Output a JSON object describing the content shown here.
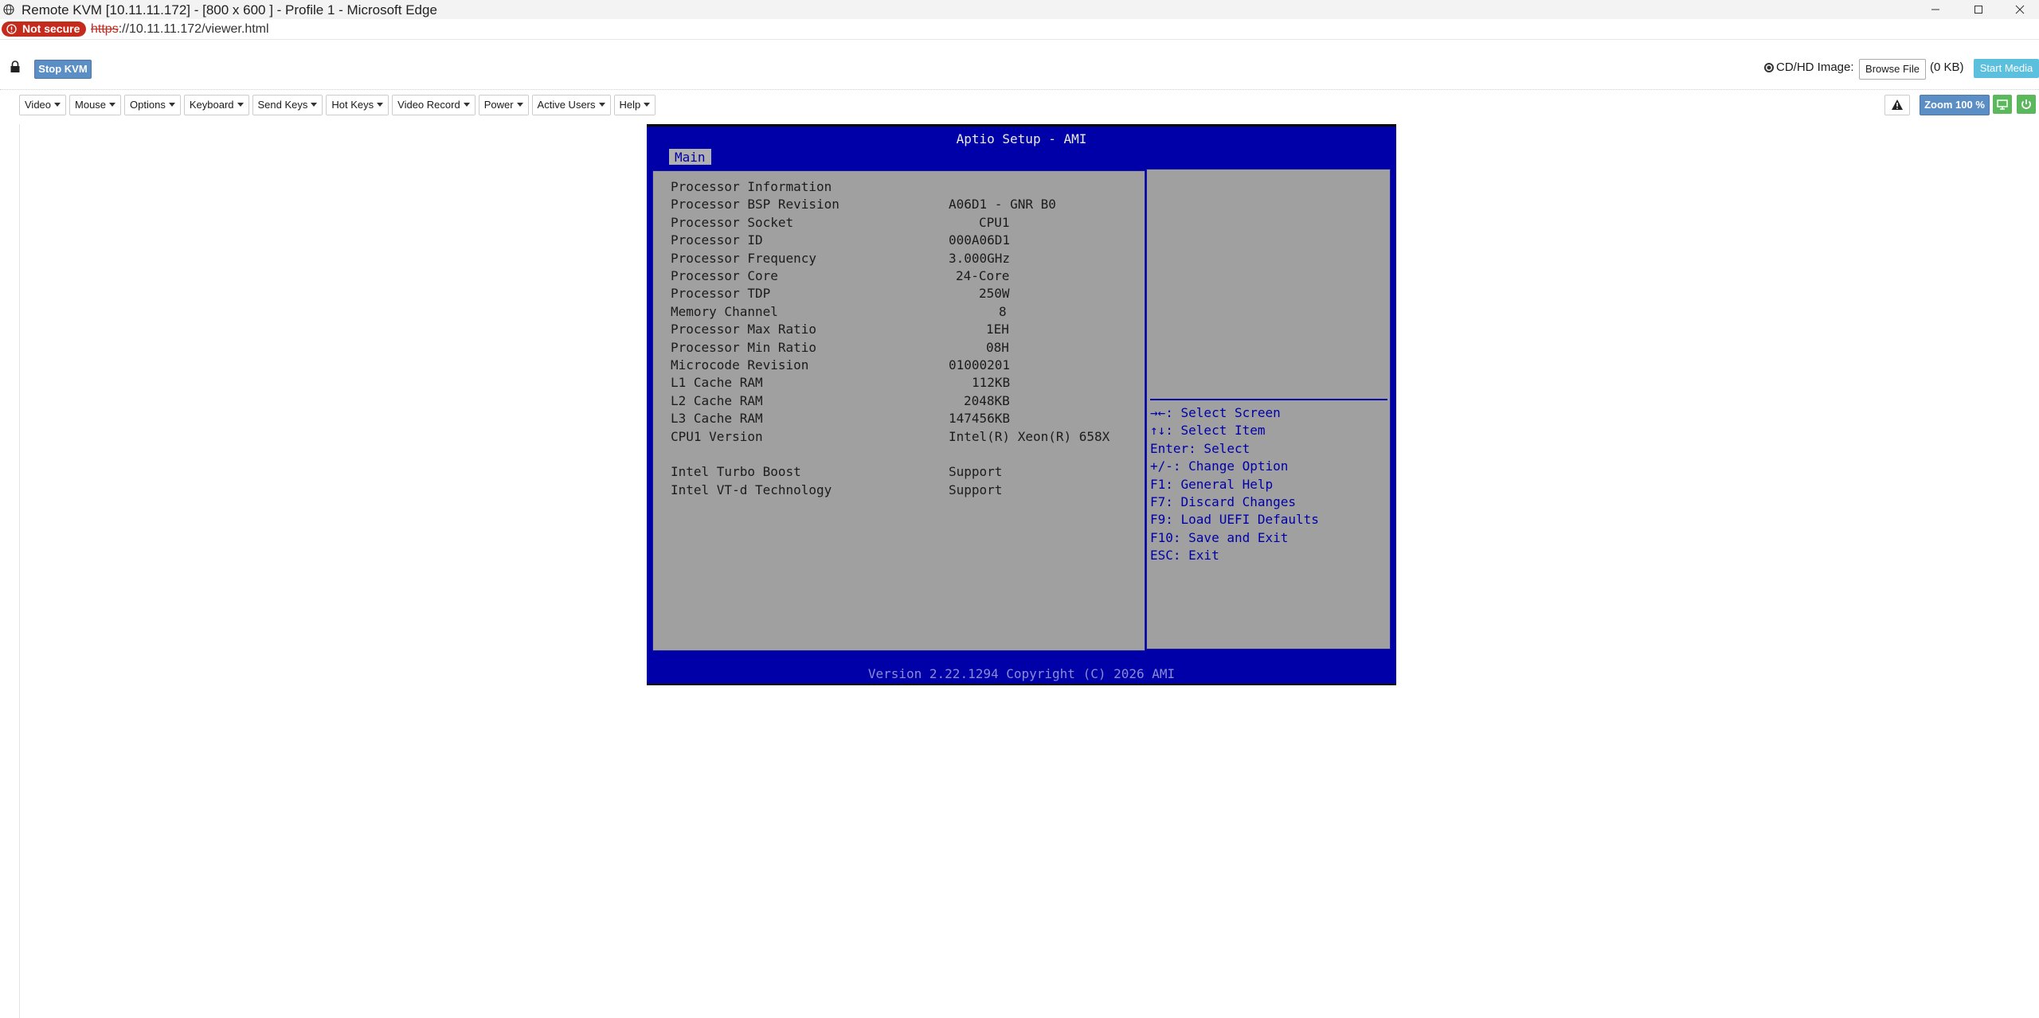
{
  "browser": {
    "window_title": "Remote KVM [10.11.11.172] - [800 x 600 ] - Profile 1 - Microsoft Edge",
    "not_secure_label": "Not secure",
    "url_scheme": "https",
    "url_rest": "://10.11.11.172/viewer.html"
  },
  "kvm_toolbar": {
    "stop_kvm_label": "Stop KVM",
    "cd_label": "CD/HD Image:",
    "browse_file_label": "Browse File",
    "file_size": "(0 KB)",
    "start_media_label": "Start Media",
    "zoom_label": "Zoom 100 %"
  },
  "menus": [
    "Video",
    "Mouse",
    "Options",
    "Keyboard",
    "Send Keys",
    "Hot Keys",
    "Video Record",
    "Power",
    "Active Users",
    "Help"
  ],
  "bios": {
    "title": "Aptio Setup - AMI",
    "tab": "Main",
    "section_header": "Processor Information",
    "rows": [
      {
        "label": "Processor BSP Revision",
        "value": "A06D1 - GNR B0"
      },
      {
        "label": "Processor Socket",
        "value": "CPU1"
      },
      {
        "label": "Processor ID",
        "value": "000A06D1"
      },
      {
        "label": "Processor Frequency",
        "value": "3.000GHz"
      },
      {
        "label": "Processor Core",
        "value": "24-Core"
      },
      {
        "label": "Processor TDP",
        "value": "250W"
      },
      {
        "label": "Memory Channel",
        "value": "8"
      },
      {
        "label": "Processor Max Ratio",
        "value": "1EH"
      },
      {
        "label": "Processor Min Ratio",
        "value": "08H"
      },
      {
        "label": "Microcode Revision",
        "value": "01000201"
      },
      {
        "label": "L1 Cache RAM",
        "value": "112KB"
      },
      {
        "label": "L2 Cache RAM",
        "value": "2048KB"
      },
      {
        "label": "L3 Cache RAM",
        "value": "147456KB"
      },
      {
        "label": "CPU1 Version",
        "value": "Intel(R) Xeon(R) 658X"
      },
      {
        "label": "",
        "value": ""
      },
      {
        "label": "Intel Turbo Boost",
        "value": "Support"
      },
      {
        "label": "Intel VT-d Technology",
        "value": "Support"
      }
    ],
    "help": [
      "→←: Select Screen",
      "↑↓: Select Item",
      "Enter: Select",
      "+/-: Change Option",
      "F1: General Help",
      "F7: Discard Changes",
      "F9: Load UEFI Defaults",
      "F10: Save and Exit",
      "ESC: Exit"
    ],
    "footer": "Version 2.22.1294 Copyright (C) 2026 AMI"
  },
  "colors": {
    "bios_blue": "#0000a8",
    "bios_gray": "#a0a0a0",
    "not_secure_red": "#c42b1c",
    "button_blue": "#5b8ec4",
    "start_media": "#5bc0de",
    "green": "#5cb85c"
  }
}
